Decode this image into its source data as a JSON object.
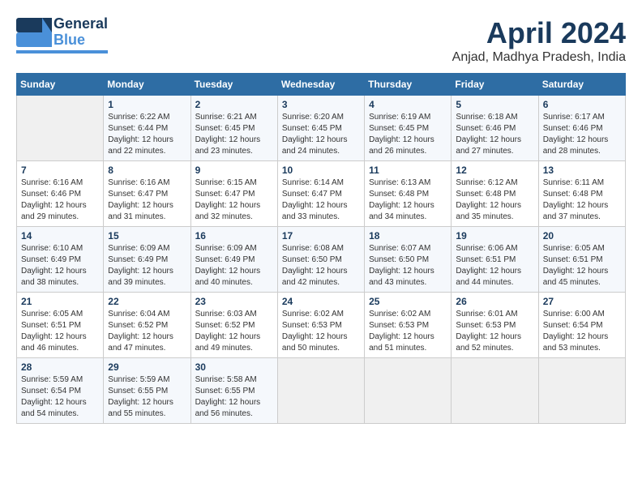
{
  "header": {
    "logo_general": "General",
    "logo_blue": "Blue",
    "month_title": "April 2024",
    "location": "Anjad, Madhya Pradesh, India"
  },
  "weekdays": [
    "Sunday",
    "Monday",
    "Tuesday",
    "Wednesday",
    "Thursday",
    "Friday",
    "Saturday"
  ],
  "weeks": [
    [
      {
        "day": "",
        "sunrise": "",
        "sunset": "",
        "daylight": ""
      },
      {
        "day": "1",
        "sunrise": "Sunrise: 6:22 AM",
        "sunset": "Sunset: 6:44 PM",
        "daylight": "Daylight: 12 hours and 22 minutes."
      },
      {
        "day": "2",
        "sunrise": "Sunrise: 6:21 AM",
        "sunset": "Sunset: 6:45 PM",
        "daylight": "Daylight: 12 hours and 23 minutes."
      },
      {
        "day": "3",
        "sunrise": "Sunrise: 6:20 AM",
        "sunset": "Sunset: 6:45 PM",
        "daylight": "Daylight: 12 hours and 24 minutes."
      },
      {
        "day": "4",
        "sunrise": "Sunrise: 6:19 AM",
        "sunset": "Sunset: 6:45 PM",
        "daylight": "Daylight: 12 hours and 26 minutes."
      },
      {
        "day": "5",
        "sunrise": "Sunrise: 6:18 AM",
        "sunset": "Sunset: 6:46 PM",
        "daylight": "Daylight: 12 hours and 27 minutes."
      },
      {
        "day": "6",
        "sunrise": "Sunrise: 6:17 AM",
        "sunset": "Sunset: 6:46 PM",
        "daylight": "Daylight: 12 hours and 28 minutes."
      }
    ],
    [
      {
        "day": "7",
        "sunrise": "Sunrise: 6:16 AM",
        "sunset": "Sunset: 6:46 PM",
        "daylight": "Daylight: 12 hours and 29 minutes."
      },
      {
        "day": "8",
        "sunrise": "Sunrise: 6:16 AM",
        "sunset": "Sunset: 6:47 PM",
        "daylight": "Daylight: 12 hours and 31 minutes."
      },
      {
        "day": "9",
        "sunrise": "Sunrise: 6:15 AM",
        "sunset": "Sunset: 6:47 PM",
        "daylight": "Daylight: 12 hours and 32 minutes."
      },
      {
        "day": "10",
        "sunrise": "Sunrise: 6:14 AM",
        "sunset": "Sunset: 6:47 PM",
        "daylight": "Daylight: 12 hours and 33 minutes."
      },
      {
        "day": "11",
        "sunrise": "Sunrise: 6:13 AM",
        "sunset": "Sunset: 6:48 PM",
        "daylight": "Daylight: 12 hours and 34 minutes."
      },
      {
        "day": "12",
        "sunrise": "Sunrise: 6:12 AM",
        "sunset": "Sunset: 6:48 PM",
        "daylight": "Daylight: 12 hours and 35 minutes."
      },
      {
        "day": "13",
        "sunrise": "Sunrise: 6:11 AM",
        "sunset": "Sunset: 6:48 PM",
        "daylight": "Daylight: 12 hours and 37 minutes."
      }
    ],
    [
      {
        "day": "14",
        "sunrise": "Sunrise: 6:10 AM",
        "sunset": "Sunset: 6:49 PM",
        "daylight": "Daylight: 12 hours and 38 minutes."
      },
      {
        "day": "15",
        "sunrise": "Sunrise: 6:09 AM",
        "sunset": "Sunset: 6:49 PM",
        "daylight": "Daylight: 12 hours and 39 minutes."
      },
      {
        "day": "16",
        "sunrise": "Sunrise: 6:09 AM",
        "sunset": "Sunset: 6:49 PM",
        "daylight": "Daylight: 12 hours and 40 minutes."
      },
      {
        "day": "17",
        "sunrise": "Sunrise: 6:08 AM",
        "sunset": "Sunset: 6:50 PM",
        "daylight": "Daylight: 12 hours and 42 minutes."
      },
      {
        "day": "18",
        "sunrise": "Sunrise: 6:07 AM",
        "sunset": "Sunset: 6:50 PM",
        "daylight": "Daylight: 12 hours and 43 minutes."
      },
      {
        "day": "19",
        "sunrise": "Sunrise: 6:06 AM",
        "sunset": "Sunset: 6:51 PM",
        "daylight": "Daylight: 12 hours and 44 minutes."
      },
      {
        "day": "20",
        "sunrise": "Sunrise: 6:05 AM",
        "sunset": "Sunset: 6:51 PM",
        "daylight": "Daylight: 12 hours and 45 minutes."
      }
    ],
    [
      {
        "day": "21",
        "sunrise": "Sunrise: 6:05 AM",
        "sunset": "Sunset: 6:51 PM",
        "daylight": "Daylight: 12 hours and 46 minutes."
      },
      {
        "day": "22",
        "sunrise": "Sunrise: 6:04 AM",
        "sunset": "Sunset: 6:52 PM",
        "daylight": "Daylight: 12 hours and 47 minutes."
      },
      {
        "day": "23",
        "sunrise": "Sunrise: 6:03 AM",
        "sunset": "Sunset: 6:52 PM",
        "daylight": "Daylight: 12 hours and 49 minutes."
      },
      {
        "day": "24",
        "sunrise": "Sunrise: 6:02 AM",
        "sunset": "Sunset: 6:53 PM",
        "daylight": "Daylight: 12 hours and 50 minutes."
      },
      {
        "day": "25",
        "sunrise": "Sunrise: 6:02 AM",
        "sunset": "Sunset: 6:53 PM",
        "daylight": "Daylight: 12 hours and 51 minutes."
      },
      {
        "day": "26",
        "sunrise": "Sunrise: 6:01 AM",
        "sunset": "Sunset: 6:53 PM",
        "daylight": "Daylight: 12 hours and 52 minutes."
      },
      {
        "day": "27",
        "sunrise": "Sunrise: 6:00 AM",
        "sunset": "Sunset: 6:54 PM",
        "daylight": "Daylight: 12 hours and 53 minutes."
      }
    ],
    [
      {
        "day": "28",
        "sunrise": "Sunrise: 5:59 AM",
        "sunset": "Sunset: 6:54 PM",
        "daylight": "Daylight: 12 hours and 54 minutes."
      },
      {
        "day": "29",
        "sunrise": "Sunrise: 5:59 AM",
        "sunset": "Sunset: 6:55 PM",
        "daylight": "Daylight: 12 hours and 55 minutes."
      },
      {
        "day": "30",
        "sunrise": "Sunrise: 5:58 AM",
        "sunset": "Sunset: 6:55 PM",
        "daylight": "Daylight: 12 hours and 56 minutes."
      },
      {
        "day": "",
        "sunrise": "",
        "sunset": "",
        "daylight": ""
      },
      {
        "day": "",
        "sunrise": "",
        "sunset": "",
        "daylight": ""
      },
      {
        "day": "",
        "sunrise": "",
        "sunset": "",
        "daylight": ""
      },
      {
        "day": "",
        "sunrise": "",
        "sunset": "",
        "daylight": ""
      }
    ]
  ]
}
